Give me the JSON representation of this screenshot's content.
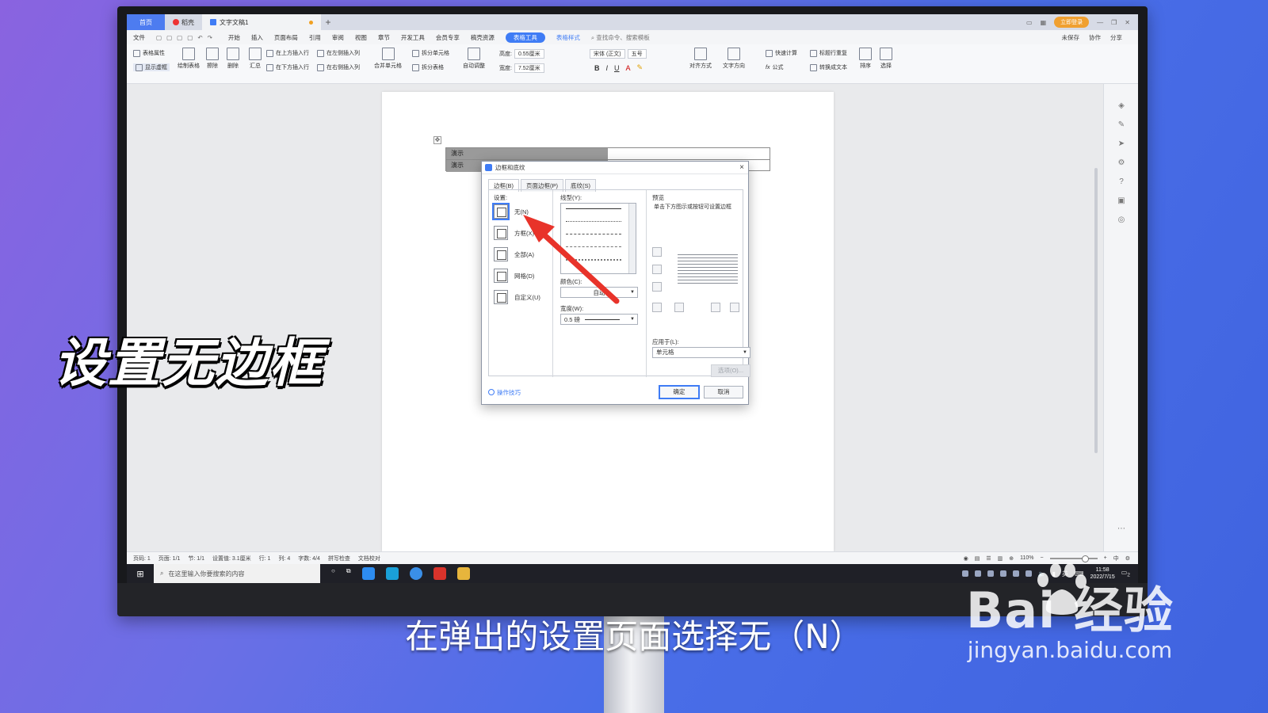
{
  "titlebar": {
    "home_tab": "首页",
    "shell_tab": "稻壳",
    "doc_tab": "文字文稿1",
    "new_tab": "+",
    "login_button": "立即登录"
  },
  "menubar": {
    "file": "文件",
    "items": [
      "开始",
      "插入",
      "页面布局",
      "引用",
      "审阅",
      "视图",
      "章节",
      "开发工具",
      "会员专享",
      "稿壳资源"
    ],
    "active_tab": "表格工具",
    "style_tab": "表格样式",
    "search": "查找命令、搜索模板",
    "unsaved": "未保存",
    "collab": "协作",
    "share": "分享"
  },
  "ribbon": {
    "table_props": "表格属性",
    "show_gridlines": "显示虚框",
    "draw_table": "绘制表格",
    "erase": "擦除",
    "delete": "删除",
    "summary": "汇总",
    "insert_row_above": "在上方插入行",
    "insert_row_below": "在下方插入行",
    "insert_col_left": "在左侧插入列",
    "insert_col_right": "在右侧插入列",
    "merge_cells": "合并单元格",
    "split_cells": "拆分单元格",
    "split_table": "拆分表格",
    "autofit": "自动调整",
    "height_label": "高度:",
    "height_value": "0.55厘米",
    "width_label": "宽度:",
    "width_value": "7.52厘米",
    "font_name": "宋体 (正文)",
    "font_size": "五号",
    "align": "对齐方式",
    "text_dir": "文字方向",
    "quick_calc": "快速计算",
    "repeat_header": "标题行重复",
    "formula": "公式",
    "to_text": "转换成文本",
    "sort": "排序",
    "select": "选择"
  },
  "document": {
    "cell_1": "演示",
    "cell_2": "演示"
  },
  "dialog": {
    "title": "边框和底纹",
    "close": "×",
    "tabs": [
      "边框(B)",
      "页面边框(P)",
      "底纹(S)"
    ],
    "settings_label": "设置:",
    "settings": [
      "无(N)",
      "方框(X)",
      "全部(A)",
      "网格(D)",
      "自定义(U)"
    ],
    "linestyle_label": "线型(Y):",
    "color_label": "颜色(C):",
    "color_value": "自动",
    "width_label": "宽度(W):",
    "width_value": "0.5  磅",
    "preview_label": "预览",
    "preview_hint": "单击下方图示或按钮可设置边框",
    "apply_label": "应用于(L):",
    "apply_value": "单元格",
    "options_button": "选项(O)...",
    "tips": "操作技巧",
    "ok": "确定",
    "cancel": "取消"
  },
  "statusbar": {
    "page_num": "页码: 1",
    "pages": "页面: 1/1",
    "section": "节: 1/1",
    "setting": "设置值: 3.1厘米",
    "row": "行: 1",
    "col": "列: 4",
    "words": "字数: 4/4",
    "spell": "拼写检查",
    "proof": "文档校对",
    "zoom": "110%",
    "ime": "中"
  },
  "taskbar": {
    "search_placeholder": "在这里输入你要搜索的内容",
    "time": "11:58",
    "date": "2022/7/15",
    "lang": "英",
    "notif": "2"
  },
  "overlay": {
    "big_caption": "设置无边框",
    "subtitle": "在弹出的设置页面选择无（N）",
    "watermark_logo": "Bai 经验",
    "watermark_url": "jingyan.baidu.com"
  },
  "colors": {
    "accent": "#3f7cf5",
    "arrow": "#e8332a",
    "background_start": "#8a63e0",
    "background_end": "#3f63df"
  }
}
